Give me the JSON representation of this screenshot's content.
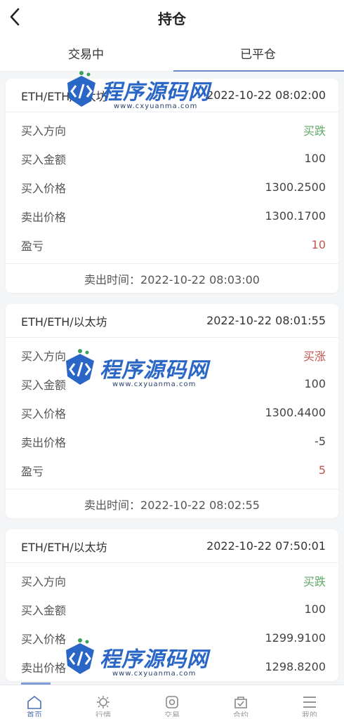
{
  "header": {
    "title": "持仓"
  },
  "tabs": [
    {
      "label": "交易中",
      "active": false
    },
    {
      "label": "已平仓",
      "active": true
    }
  ],
  "cards": [
    {
      "symbol": "ETH/ETH/以太坊",
      "time": "2022-10-22 08:02:00",
      "rows": [
        {
          "label": "买入方向",
          "value": "买跌",
          "tone": "green"
        },
        {
          "label": "买入金额",
          "value": "100",
          "tone": ""
        },
        {
          "label": "买入价格",
          "value": "1300.2500",
          "tone": ""
        },
        {
          "label": "卖出价格",
          "value": "1300.1700",
          "tone": ""
        },
        {
          "label": "盈亏",
          "value": "10",
          "tone": "red"
        }
      ],
      "footer": "卖出时间：2022-10-22 08:03:00"
    },
    {
      "symbol": "ETH/ETH/以太坊",
      "time": "2022-10-22 08:01:55",
      "rows": [
        {
          "label": "买入方向",
          "value": "买涨",
          "tone": "red"
        },
        {
          "label": "买入金额",
          "value": "100",
          "tone": ""
        },
        {
          "label": "买入价格",
          "value": "1300.4400",
          "tone": ""
        },
        {
          "label": "卖出价格",
          "value": "-5",
          "tone": ""
        },
        {
          "label": "盈亏",
          "value": "5",
          "tone": "red"
        }
      ],
      "footer": "卖出时间：2022-10-22 08:02:55"
    },
    {
      "symbol": "ETH/ETH/以太坊",
      "time": "2022-10-22 07:50:01",
      "rows": [
        {
          "label": "买入方向",
          "value": "买跌",
          "tone": "green"
        },
        {
          "label": "买入金额",
          "value": "100",
          "tone": ""
        },
        {
          "label": "买入价格",
          "value": "1299.9100",
          "tone": ""
        },
        {
          "label": "卖出价格",
          "value": "1298.8200",
          "tone": ""
        }
      ],
      "footer": ""
    }
  ],
  "watermark": {
    "text": "程序源码网",
    "url": "www.cxyuanma.com"
  },
  "tabbar": [
    {
      "label": "首页",
      "icon": "home-icon",
      "active": true
    },
    {
      "label": "行情",
      "icon": "market-icon",
      "active": false
    },
    {
      "label": "交易",
      "icon": "trade-icon",
      "active": false
    },
    {
      "label": "合约",
      "icon": "contract-icon",
      "active": false
    },
    {
      "label": "我的",
      "icon": "menu-icon",
      "active": false
    }
  ],
  "colors": {
    "accent": "#6f89c8",
    "up_green": "#62a86b",
    "down_red": "#c0564e"
  }
}
